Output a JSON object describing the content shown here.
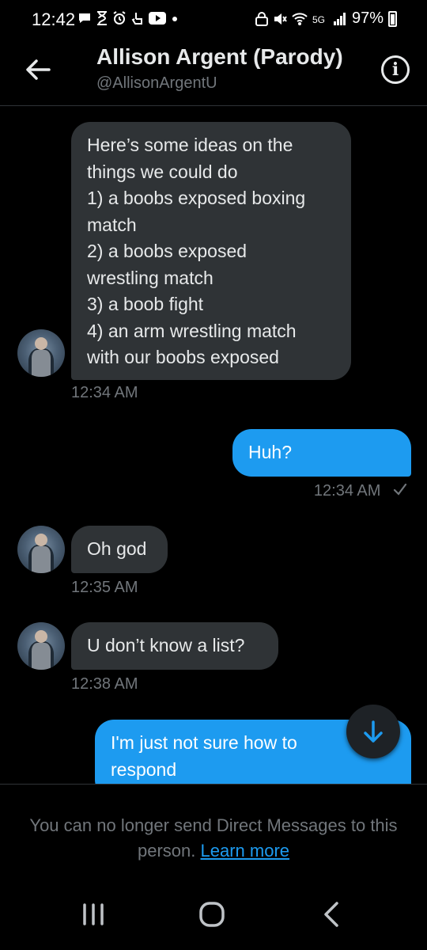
{
  "status_bar": {
    "time": "12:42",
    "battery": "97%",
    "left_icons": [
      "chat-icon",
      "hourglass-icon",
      "alarm-icon",
      "hand-icon",
      "youtube-icon",
      "dot-icon"
    ],
    "right_icons": [
      "lock-icon",
      "mute-icon",
      "wifi-icon",
      "5g-icon",
      "signal-icon",
      "battery-icon"
    ]
  },
  "header": {
    "title": "Allison Argent (Parody)",
    "handle": "@AllisonArgentU",
    "back_icon": "arrow-left-icon",
    "info_icon": "info-icon"
  },
  "messages": [
    {
      "direction": "in",
      "lines": [
        "Here’s some ideas on the",
        "things we could do",
        "1) a boobs exposed boxing",
        "match",
        "2) a boobs exposed",
        "wrestling match",
        "3) a boob fight",
        "4) an arm wrestling match",
        "with our boobs exposed"
      ],
      "time": "12:34 AM"
    },
    {
      "direction": "out",
      "lines": [
        "Huh?"
      ],
      "time": "12:34 AM"
    },
    {
      "direction": "in",
      "lines": [
        "Oh god"
      ],
      "time": "12:35 AM"
    },
    {
      "direction": "in",
      "lines": [
        "U don’t know a list?"
      ],
      "time": "12:38 AM"
    },
    {
      "direction": "out",
      "lines": [
        "I'm just not sure how to",
        "respond"
      ]
    }
  ],
  "footer": {
    "notice": "You can no longer send Direct Messages to this person.",
    "learn_more": "Learn more"
  },
  "colors": {
    "background": "#000000",
    "incoming_bubble": "#2f3336",
    "outgoing_bubble": "#1d9bf0",
    "muted_text": "#71767b",
    "link": "#1d9bf0"
  },
  "nav_icons": [
    "recent-apps-icon",
    "home-icon",
    "back-icon"
  ]
}
